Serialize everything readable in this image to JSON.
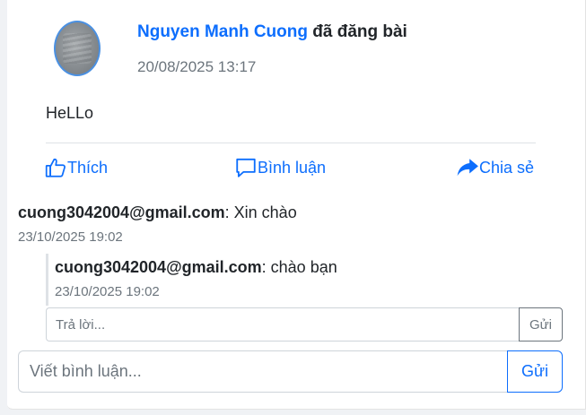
{
  "post": {
    "author": "Nguyen Manh Cuong",
    "action": "đã đăng bài",
    "time": "20/08/2025 13:17",
    "content": "HeLLo"
  },
  "actions": {
    "like": {
      "label": "Thích",
      "icon": "thumbs-up-icon"
    },
    "comment": {
      "label": "Bình luận",
      "icon": "comment-bubble-icon"
    },
    "share": {
      "label": "Chia sẻ",
      "icon": "share-arrow-icon"
    }
  },
  "comments": [
    {
      "author": "cuong3042004@gmail.com",
      "text": ": Xin chào",
      "time": "23/10/2025 19:02",
      "replies": [
        {
          "author": "cuong3042004@gmail.com",
          "text": ": chào bạn",
          "time": "23/10/2025 19:02"
        }
      ]
    }
  ],
  "reply_form": {
    "placeholder": "Trả lời...",
    "send_label": "Gửi"
  },
  "comment_form": {
    "placeholder": "Viết bình luận...",
    "send_label": "Gửi"
  },
  "colors": {
    "primary": "#0d6efd",
    "muted": "#6c757d",
    "border": "#ced4da"
  }
}
